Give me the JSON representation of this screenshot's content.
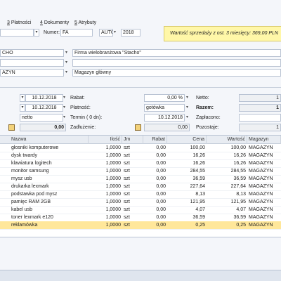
{
  "tabs": [
    {
      "key": "3",
      "label": "Płatności"
    },
    {
      "key": "4",
      "label": "Dokumenty"
    },
    {
      "key": "5",
      "label": "Atrybuty"
    }
  ],
  "header": {
    "numer_label": "Numer:",
    "numer_prefix": "FA",
    "numer_mode": "AUTO",
    "numer_year": "2018",
    "banner": "Wartość sprzedaży z ost. 3 miesięcy: 369,00 PLN"
  },
  "contractor": {
    "code": "CHO",
    "name": "Firma wielobranżowa \"Stacho\"",
    "warehouse_code": "AZYN",
    "warehouse_name": "Magazyn główny"
  },
  "dates": {
    "date1": "10.12.2018",
    "date2": "10.12.2018",
    "price_type": "netto",
    "sum_left": "0,00"
  },
  "payment": {
    "rabat_label": "Rabat:",
    "rabat_value": "0,00 %",
    "platnosc_label": "Płatność:",
    "platnosc_value": "gotówka",
    "termin_label": "Termin",
    "termin_days": "( 0 dn):",
    "termin_date": "10.12.2018",
    "zadluzenie_label": "Zadłużenie:",
    "zadluzenie_value": "0,00"
  },
  "totals": {
    "netto_label": "Netto:",
    "netto_value": "1",
    "razem_label": "Razem:",
    "razem_value": "1",
    "zaplacono_label": "Zapłacono:",
    "zaplacono_value": "",
    "pozostaje_label": "Pozostaje:",
    "pozostaje_value": "1"
  },
  "grid": {
    "columns": [
      "Nazwa",
      "Ilość",
      "Jm",
      "Rabat",
      "Cena",
      "Wartość",
      "Magazyn"
    ],
    "rows": [
      [
        "głosniki komputerowe",
        "1,0000",
        "szt",
        "0,00",
        "100,00",
        "100,00",
        "MAGAZYN"
      ],
      [
        "dysk twardy",
        "1,0000",
        "szt",
        "0,00",
        "16,26",
        "16,26",
        "MAGAZYN"
      ],
      [
        "klawiatura logitech",
        "1,0000",
        "szt",
        "0,00",
        "16,26",
        "16,26",
        "MAGAZYN"
      ],
      [
        "monitor samsung",
        "1,0000",
        "szt",
        "0,00",
        "284,55",
        "284,55",
        "MAGAZYN"
      ],
      [
        "mysz usb",
        "1,0000",
        "szt",
        "0,00",
        "36,59",
        "36,59",
        "MAGAZYN"
      ],
      [
        "drukarka lexmark",
        "1,0000",
        "szt",
        "0,00",
        "227,64",
        "227,64",
        "MAGAZYN"
      ],
      [
        "podstawka pod mysz",
        "1,0000",
        "szt",
        "0,00",
        "8,13",
        "8,13",
        "MAGAZYN"
      ],
      [
        "pamięc RAM 2GB",
        "1,0000",
        "szt",
        "0,00",
        "121,95",
        "121,95",
        "MAGAZYN"
      ],
      [
        "kabel usb",
        "1,0000",
        "szt",
        "0,00",
        "4,07",
        "4,07",
        "MAGAZYN"
      ],
      [
        "toner lexmark e120",
        "1,0000",
        "szt",
        "0,00",
        "36,59",
        "36,59",
        "MAGAZYN"
      ],
      [
        "reklamówka",
        "1,0000",
        "szt",
        "0,00",
        "0,25",
        "0,25",
        "MAGAZYN"
      ]
    ],
    "selected_index": 10
  },
  "icons": {
    "dropdown": "chevron-down-icon",
    "calendar": "calendar-icon"
  }
}
